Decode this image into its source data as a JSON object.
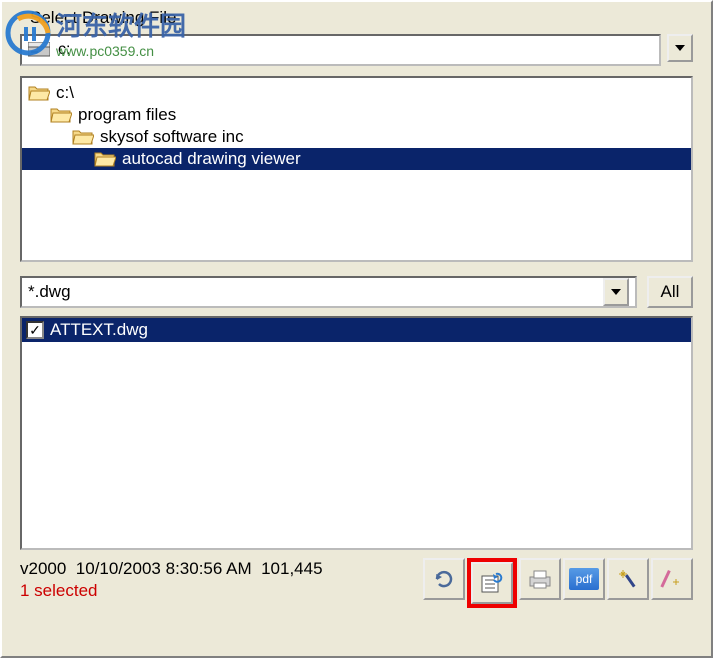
{
  "title": "Select Drawing File",
  "drive": {
    "label": "c:"
  },
  "tree": {
    "items": [
      {
        "label": "c:\\",
        "indent": 0,
        "selected": false
      },
      {
        "label": "program files",
        "indent": 1,
        "selected": false
      },
      {
        "label": "skysof software inc",
        "indent": 2,
        "selected": false
      },
      {
        "label": "autocad drawing viewer",
        "indent": 3,
        "selected": true
      }
    ]
  },
  "filter": {
    "value": "*.dwg",
    "all_label": "All"
  },
  "files": [
    {
      "name": "ATTEXT.dwg",
      "checked": true
    }
  ],
  "status": {
    "version": "v2000",
    "date": "10/10/2003",
    "time": "8:30:56 AM",
    "size": "101,445",
    "selected": "1 selected"
  },
  "toolbar": {
    "pdf_label": "pdf"
  },
  "watermark": {
    "main": "河东软件园",
    "sub": "www.pc0359.cn"
  }
}
